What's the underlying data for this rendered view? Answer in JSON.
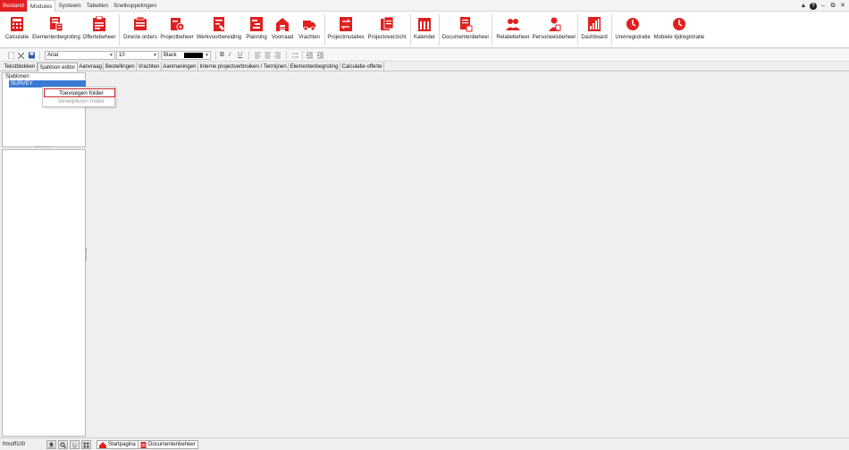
{
  "menu": {
    "items": [
      {
        "label": "Bestand"
      },
      {
        "label": "Modules"
      },
      {
        "label": "Systeem"
      },
      {
        "label": "Tabellen"
      },
      {
        "label": "Snelkoppelingen"
      }
    ]
  },
  "window_controls": {
    "help": "?"
  },
  "ribbon": {
    "buttons": [
      {
        "label": "Calculatie",
        "icon": "calculatie-icon"
      },
      {
        "label": "Elementenbegroting",
        "icon": "elementenbegroting-icon"
      },
      {
        "label": "Offertebeheer",
        "icon": "offertebeheer-icon"
      },
      {
        "label": "Directe orders",
        "icon": "directe-orders-icon"
      },
      {
        "label": "Projectbeheer",
        "icon": "projectbeheer-icon"
      },
      {
        "label": "Werkvoorbereiding",
        "icon": "werkvoorbereiding-icon"
      },
      {
        "label": "Planning",
        "icon": "planning-icon"
      },
      {
        "label": "Voorraad",
        "icon": "voorraad-icon"
      },
      {
        "label": "Vrachten",
        "icon": "vrachten-icon"
      },
      {
        "label": "Projectmutaties",
        "icon": "projectmutaties-icon"
      },
      {
        "label": "Projectoverzicht",
        "icon": "projectoverzicht-icon"
      },
      {
        "label": "Kalender",
        "icon": "kalender-icon"
      },
      {
        "label": "Documentenbeheer",
        "icon": "documentenbeheer-icon"
      },
      {
        "label": "Relatiebeheer",
        "icon": "relatiebeheer-icon"
      },
      {
        "label": "Personeelsbeheer",
        "icon": "personeelsbeheer-icon"
      },
      {
        "label": "Dashboard",
        "icon": "dashboard-icon"
      },
      {
        "label": "Urenregistratie",
        "icon": "clock-icon"
      },
      {
        "label": "Mobiele tijdregistratie",
        "icon": "clock-icon"
      }
    ]
  },
  "toolbar": {
    "font": "Arial",
    "size": "10",
    "color_name": "Black",
    "color_value": "#000000"
  },
  "tabs": [
    {
      "label": "Tekstblokken"
    },
    {
      "label": "Sjabloon editor"
    },
    {
      "label": "Aanvraag"
    },
    {
      "label": "Bestellingen"
    },
    {
      "label": "Vrachten"
    },
    {
      "label": "Aanmaningen"
    },
    {
      "label": "Interne projectverbruiken / Termijnen"
    },
    {
      "label": "Elementenbegroting"
    },
    {
      "label": "Calculatie offerte"
    }
  ],
  "panel": {
    "title": "Sjablonen",
    "tree_item": "SURVEY"
  },
  "context_menu": {
    "add_folder": "Toevoegen folder",
    "remove_folder": "Verwijderen folder"
  },
  "statusbar": {
    "form_name": "frmoff100",
    "tab_home": "Startpagina",
    "tab_docs": "Documentenbeheer"
  },
  "colors": {
    "accent": "#e02020",
    "selection": "#3a7bd5"
  }
}
